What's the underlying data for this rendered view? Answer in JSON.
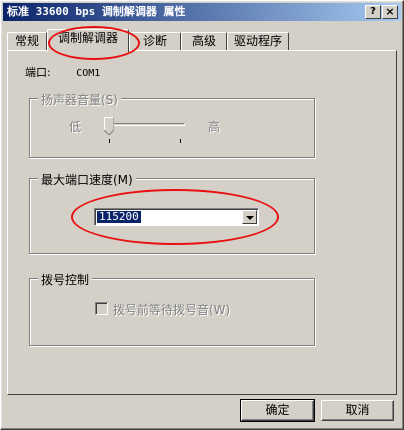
{
  "window": {
    "title": "标准 33600 bps 调制解调器 属性",
    "help_btn": "?",
    "close_btn": "×"
  },
  "tabs": [
    {
      "label": "常规"
    },
    {
      "label": "调制解调器"
    },
    {
      "label": "诊断"
    },
    {
      "label": "高级"
    },
    {
      "label": "驱动程序"
    }
  ],
  "active_tab": 1,
  "port": {
    "label": "端口:",
    "value": "COM1"
  },
  "speaker": {
    "group_label": "扬声器音量(S)",
    "low_label": "低",
    "high_label": "高",
    "level_fraction": 0.0,
    "disabled": true
  },
  "max_speed": {
    "group_label": "最大端口速度(M)",
    "selected": "115200"
  },
  "dial": {
    "group_label": "拨号控制",
    "checkbox_label": "拨号前等待拨号音(W)",
    "checked": false,
    "disabled": true
  },
  "buttons": {
    "ok": "确定",
    "cancel": "取消"
  },
  "colors": {
    "face": "#d4d0c8",
    "title_start": "#0a246a",
    "title_end": "#a6caf0",
    "selection": "#0a246a",
    "annotation": "#e81010"
  }
}
